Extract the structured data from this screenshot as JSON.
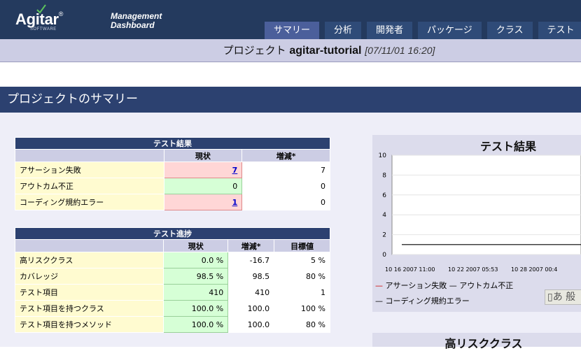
{
  "header": {
    "logo_text": "Agitar",
    "logo_reg": "®",
    "logo_sub": "SOFTWARE",
    "dashboard_line1": "Management",
    "dashboard_line2": "Dashboard",
    "tabs": [
      {
        "label": "サマリー",
        "active": true
      },
      {
        "label": "分析",
        "active": false
      },
      {
        "label": "開発者",
        "active": false
      },
      {
        "label": "パッケージ",
        "active": false
      },
      {
        "label": "クラス",
        "active": false
      },
      {
        "label": "テスト",
        "active": false
      }
    ]
  },
  "project_bar": {
    "prefix": "プロジェクト",
    "name": "agitar-tutorial",
    "date": "[07/11/01 16:20]"
  },
  "summary": {
    "title": "プロジェクトのサマリー",
    "test_results": {
      "title": "テスト結果",
      "headers": [
        "現状",
        "増減*"
      ],
      "rows": [
        {
          "label": "アサーション失敗",
          "current": "7",
          "delta": "7"
        },
        {
          "label": "アウトカム不正",
          "current": "0",
          "delta": "0"
        },
        {
          "label": "コーディング規約エラー",
          "current": "1",
          "delta": "0"
        }
      ]
    },
    "test_progress": {
      "title": "テスト進捗",
      "headers": [
        "現状",
        "増減*",
        "目標値"
      ],
      "rows": [
        {
          "label": "高リスククラス",
          "current": "0.0 %",
          "delta": "-16.7",
          "target": "5 %"
        },
        {
          "label": "カバレッジ",
          "current": "98.5 %",
          "delta": "98.5",
          "target": "80 %"
        },
        {
          "label": "テスト項目",
          "current": "410",
          "delta": "410",
          "target": "1"
        },
        {
          "label": "テスト項目を持つクラス",
          "current": "100.0 %",
          "delta": "100.0",
          "target": "100 %"
        },
        {
          "label": "テスト項目を持つメソッド",
          "current": "100.0 %",
          "delta": "100.0",
          "target": "80 %"
        }
      ]
    }
  },
  "chart_data": {
    "type": "line",
    "title": "テスト結果",
    "xlabel": "",
    "ylabel": "",
    "ylim": [
      0,
      10
    ],
    "yticks": [
      "0",
      "2",
      "4",
      "6",
      "8",
      "10"
    ],
    "xticks": [
      "10 16 2007 11:00",
      "10 22 2007 05:53",
      "10 28 2007 00:4"
    ],
    "series": [
      {
        "name": "アサーション失敗",
        "color": "#cc0000",
        "values": []
      },
      {
        "name": "アウトカム不正",
        "color": "#000000",
        "values": [
          1,
          1
        ]
      },
      {
        "name": "コーディング規約エラー",
        "color": "#000000",
        "values": []
      }
    ],
    "legend_button": "あ 般"
  },
  "second_chart": {
    "title": "高リスククラス"
  },
  "colors": {
    "nav_bg": "#243a5e",
    "tab_bg": "#2f4b78",
    "tab_active": "#4b5f9b",
    "panel_head": "#2c4170",
    "label_bg": "#fffbd0",
    "bad_bg": "#ffd6d6",
    "good_bg": "#d6ffd6"
  }
}
